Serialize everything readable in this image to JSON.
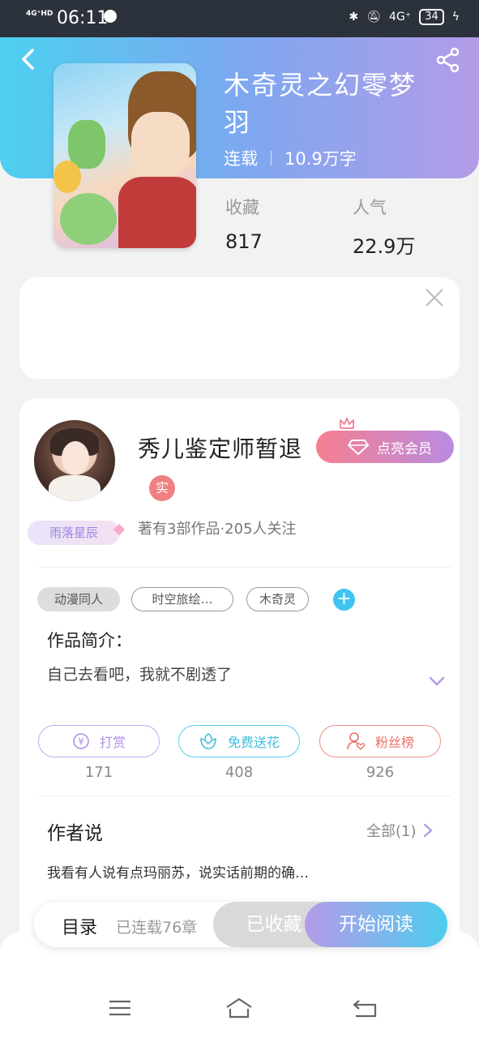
{
  "status_bar": {
    "network_label": "4G⁺HD",
    "time": "06:11",
    "network_right": "4G⁺",
    "battery": "34"
  },
  "book": {
    "title": "木奇灵之幻零梦羽",
    "status": "连载",
    "word_count": "10.9万字",
    "favorites_label": "收藏",
    "favorites_value": "817",
    "popularity_label": "人气",
    "popularity_value": "22.9万"
  },
  "author": {
    "name": "秀儿鉴定师暂退",
    "verified_badge": "实",
    "tag": "雨落星辰",
    "meta": "著有3部作品·205人关注",
    "vip_button": "点亮会员"
  },
  "tags": [
    "动漫同人",
    "时空旅绘…",
    "木奇灵"
  ],
  "intro": {
    "title": "作品简介：",
    "text": "自己去看吧，我就不剧透了"
  },
  "actions": [
    {
      "label": "打赏",
      "count": "171"
    },
    {
      "label": "免费送花",
      "count": "408"
    },
    {
      "label": "粉丝榜",
      "count": "926"
    }
  ],
  "author_says": {
    "title": "作者说",
    "all_label": "全部(1)",
    "text": "我看有人说有点玛丽苏，说实话前期的确…"
  },
  "bottom_bar": {
    "toc_label": "目录",
    "chapter_count": "已连载76章",
    "saved_label": "已收藏",
    "read_label": "开始阅读"
  },
  "colors": {
    "header_gradient_start": "#4dd0f0",
    "header_gradient_end": "#b49be8",
    "accent_blue": "#3fc3ef",
    "accent_pink": "#f57f8f",
    "accent_purple": "#b98be2"
  }
}
